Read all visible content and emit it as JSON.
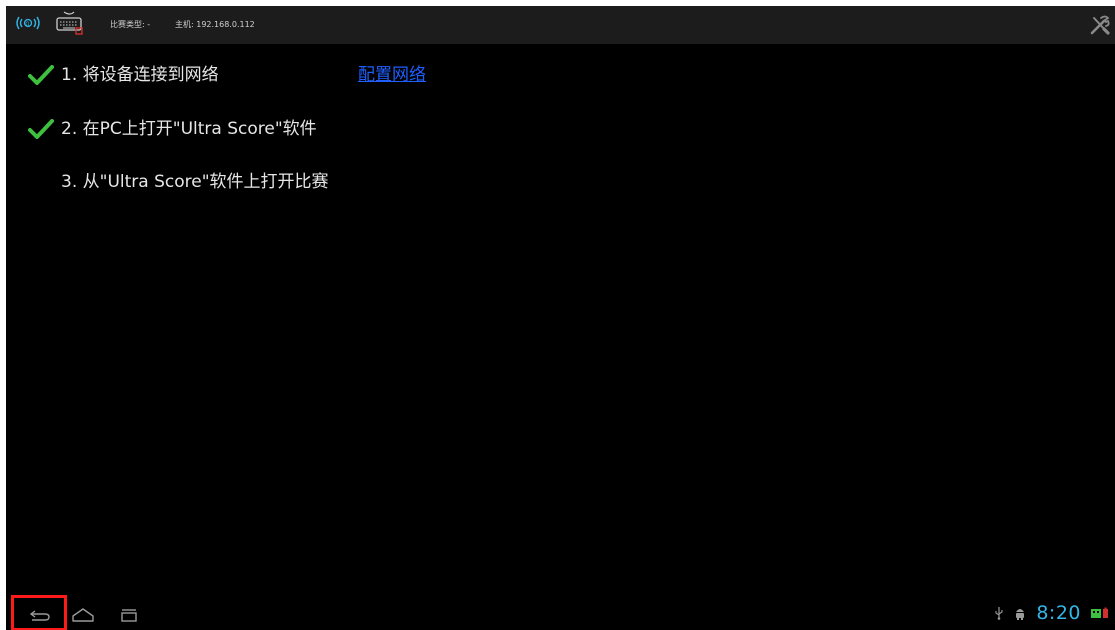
{
  "status_bar": {
    "match_type": "比赛类型: -",
    "host": "主机: 192.168.0.112"
  },
  "steps": [
    {
      "label": "1. 将设备连接到网络",
      "checked": true
    },
    {
      "label": "2. 在PC上打开\"Ultra Score\"软件",
      "checked": true
    },
    {
      "label": "3. 从\"Ultra Score\"软件上打开比赛",
      "checked": false
    }
  ],
  "configure_network_link": "配置网络",
  "nav_bar": {
    "clock": "8:20",
    "highlighted_button": "back"
  },
  "colors": {
    "background": "#000000",
    "check": "#3fbf3f",
    "link": "#1f5fff",
    "clock": "#33b5e5",
    "highlight": "#ff1a1a"
  },
  "icons": [
    "wifi-signal-icon",
    "keyboard-icon",
    "settings-tools-icon",
    "check-icon",
    "back-icon",
    "home-icon",
    "recent-apps-icon",
    "usb-icon",
    "android-debug-icon",
    "battery-icon"
  ]
}
